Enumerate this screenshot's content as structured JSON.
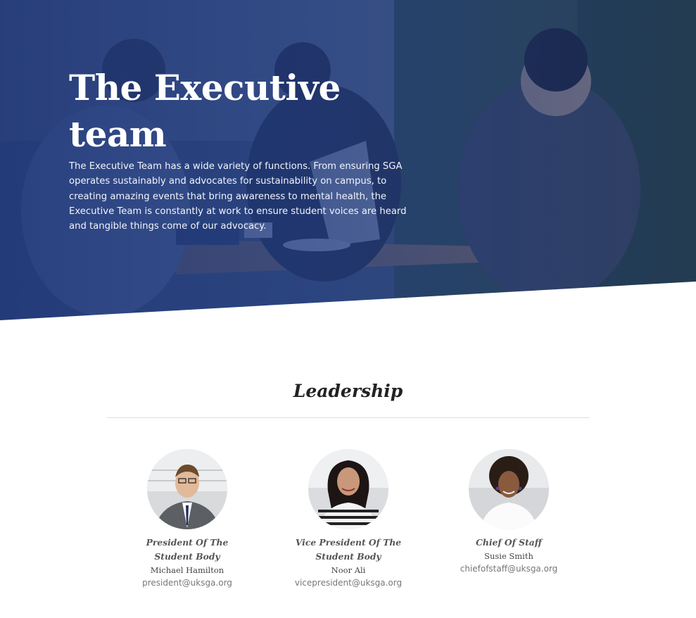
{
  "hero": {
    "title": "The Executive team",
    "description": "The Executive Team has a wide variety of functions. From ensuring SGA operates sustainably and advocates for sustainability on campus, to creating amazing events that bring awareness to mental health, the Executive Team is constantly at work to ensure student voices are heard and tangible things come of our advocacy."
  },
  "leadership": {
    "heading": "Leadership",
    "members": [
      {
        "role": "President Of The Student Body",
        "name": "Michael Hamilton",
        "email": "president@uksga.org"
      },
      {
        "role": "Vice President Of The Student Body",
        "name": "Noor Ali",
        "email": "vicepresident@uksga.org"
      },
      {
        "role": "Chief Of Staff",
        "name": "Susie Smith",
        "email": "chiefofstaff@uksga.org"
      }
    ]
  },
  "colors": {
    "overlay_blue": "#1c3478",
    "heading_text": "#222222",
    "divider": "#dedede"
  }
}
